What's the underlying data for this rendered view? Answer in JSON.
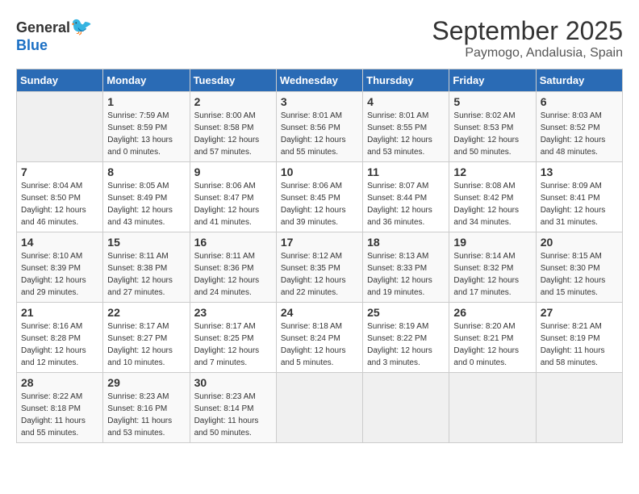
{
  "header": {
    "logo_general": "General",
    "logo_blue": "Blue",
    "month": "September 2025",
    "location": "Paymogo, Andalusia, Spain"
  },
  "days_of_week": [
    "Sunday",
    "Monday",
    "Tuesday",
    "Wednesday",
    "Thursday",
    "Friday",
    "Saturday"
  ],
  "weeks": [
    [
      {
        "day": "",
        "info": ""
      },
      {
        "day": "1",
        "info": "Sunrise: 7:59 AM\nSunset: 8:59 PM\nDaylight: 13 hours\nand 0 minutes."
      },
      {
        "day": "2",
        "info": "Sunrise: 8:00 AM\nSunset: 8:58 PM\nDaylight: 12 hours\nand 57 minutes."
      },
      {
        "day": "3",
        "info": "Sunrise: 8:01 AM\nSunset: 8:56 PM\nDaylight: 12 hours\nand 55 minutes."
      },
      {
        "day": "4",
        "info": "Sunrise: 8:01 AM\nSunset: 8:55 PM\nDaylight: 12 hours\nand 53 minutes."
      },
      {
        "day": "5",
        "info": "Sunrise: 8:02 AM\nSunset: 8:53 PM\nDaylight: 12 hours\nand 50 minutes."
      },
      {
        "day": "6",
        "info": "Sunrise: 8:03 AM\nSunset: 8:52 PM\nDaylight: 12 hours\nand 48 minutes."
      }
    ],
    [
      {
        "day": "7",
        "info": "Sunrise: 8:04 AM\nSunset: 8:50 PM\nDaylight: 12 hours\nand 46 minutes."
      },
      {
        "day": "8",
        "info": "Sunrise: 8:05 AM\nSunset: 8:49 PM\nDaylight: 12 hours\nand 43 minutes."
      },
      {
        "day": "9",
        "info": "Sunrise: 8:06 AM\nSunset: 8:47 PM\nDaylight: 12 hours\nand 41 minutes."
      },
      {
        "day": "10",
        "info": "Sunrise: 8:06 AM\nSunset: 8:45 PM\nDaylight: 12 hours\nand 39 minutes."
      },
      {
        "day": "11",
        "info": "Sunrise: 8:07 AM\nSunset: 8:44 PM\nDaylight: 12 hours\nand 36 minutes."
      },
      {
        "day": "12",
        "info": "Sunrise: 8:08 AM\nSunset: 8:42 PM\nDaylight: 12 hours\nand 34 minutes."
      },
      {
        "day": "13",
        "info": "Sunrise: 8:09 AM\nSunset: 8:41 PM\nDaylight: 12 hours\nand 31 minutes."
      }
    ],
    [
      {
        "day": "14",
        "info": "Sunrise: 8:10 AM\nSunset: 8:39 PM\nDaylight: 12 hours\nand 29 minutes."
      },
      {
        "day": "15",
        "info": "Sunrise: 8:11 AM\nSunset: 8:38 PM\nDaylight: 12 hours\nand 27 minutes."
      },
      {
        "day": "16",
        "info": "Sunrise: 8:11 AM\nSunset: 8:36 PM\nDaylight: 12 hours\nand 24 minutes."
      },
      {
        "day": "17",
        "info": "Sunrise: 8:12 AM\nSunset: 8:35 PM\nDaylight: 12 hours\nand 22 minutes."
      },
      {
        "day": "18",
        "info": "Sunrise: 8:13 AM\nSunset: 8:33 PM\nDaylight: 12 hours\nand 19 minutes."
      },
      {
        "day": "19",
        "info": "Sunrise: 8:14 AM\nSunset: 8:32 PM\nDaylight: 12 hours\nand 17 minutes."
      },
      {
        "day": "20",
        "info": "Sunrise: 8:15 AM\nSunset: 8:30 PM\nDaylight: 12 hours\nand 15 minutes."
      }
    ],
    [
      {
        "day": "21",
        "info": "Sunrise: 8:16 AM\nSunset: 8:28 PM\nDaylight: 12 hours\nand 12 minutes."
      },
      {
        "day": "22",
        "info": "Sunrise: 8:17 AM\nSunset: 8:27 PM\nDaylight: 12 hours\nand 10 minutes."
      },
      {
        "day": "23",
        "info": "Sunrise: 8:17 AM\nSunset: 8:25 PM\nDaylight: 12 hours\nand 7 minutes."
      },
      {
        "day": "24",
        "info": "Sunrise: 8:18 AM\nSunset: 8:24 PM\nDaylight: 12 hours\nand 5 minutes."
      },
      {
        "day": "25",
        "info": "Sunrise: 8:19 AM\nSunset: 8:22 PM\nDaylight: 12 hours\nand 3 minutes."
      },
      {
        "day": "26",
        "info": "Sunrise: 8:20 AM\nSunset: 8:21 PM\nDaylight: 12 hours\nand 0 minutes."
      },
      {
        "day": "27",
        "info": "Sunrise: 8:21 AM\nSunset: 8:19 PM\nDaylight: 11 hours\nand 58 minutes."
      }
    ],
    [
      {
        "day": "28",
        "info": "Sunrise: 8:22 AM\nSunset: 8:18 PM\nDaylight: 11 hours\nand 55 minutes."
      },
      {
        "day": "29",
        "info": "Sunrise: 8:23 AM\nSunset: 8:16 PM\nDaylight: 11 hours\nand 53 minutes."
      },
      {
        "day": "30",
        "info": "Sunrise: 8:23 AM\nSunset: 8:14 PM\nDaylight: 11 hours\nand 50 minutes."
      },
      {
        "day": "",
        "info": ""
      },
      {
        "day": "",
        "info": ""
      },
      {
        "day": "",
        "info": ""
      },
      {
        "day": "",
        "info": ""
      }
    ]
  ]
}
